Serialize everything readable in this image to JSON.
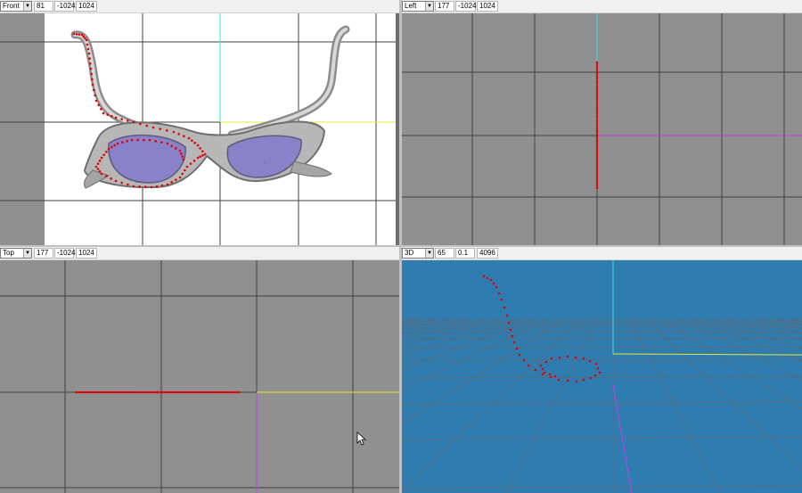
{
  "viewports": {
    "front": {
      "view": "Front",
      "field1": "81",
      "field2": "-1024",
      "field3": "1024"
    },
    "left": {
      "view": "Left",
      "field1": "177",
      "field2": "-1024",
      "field3": "1024"
    },
    "top": {
      "view": "Top",
      "field1": "177",
      "field2": "-1024",
      "field3": "1024"
    },
    "three_d": {
      "view": "3D",
      "field1": "65",
      "field2": "0.1",
      "field3": "4096"
    }
  },
  "colors": {
    "ortho_background": "#909090",
    "viewport_3d_background": "#2f7db0",
    "grid_line": "#303030",
    "axis_cyan": "#40e0e0",
    "axis_yellow": "#e8e830",
    "axis_magenta": "#c040e0",
    "point": "#e00000"
  },
  "icons": {
    "dropdown": "chevron-down-icon",
    "cursor": "mouse-pointer-icon",
    "reference_image": "sunglasses-image"
  }
}
